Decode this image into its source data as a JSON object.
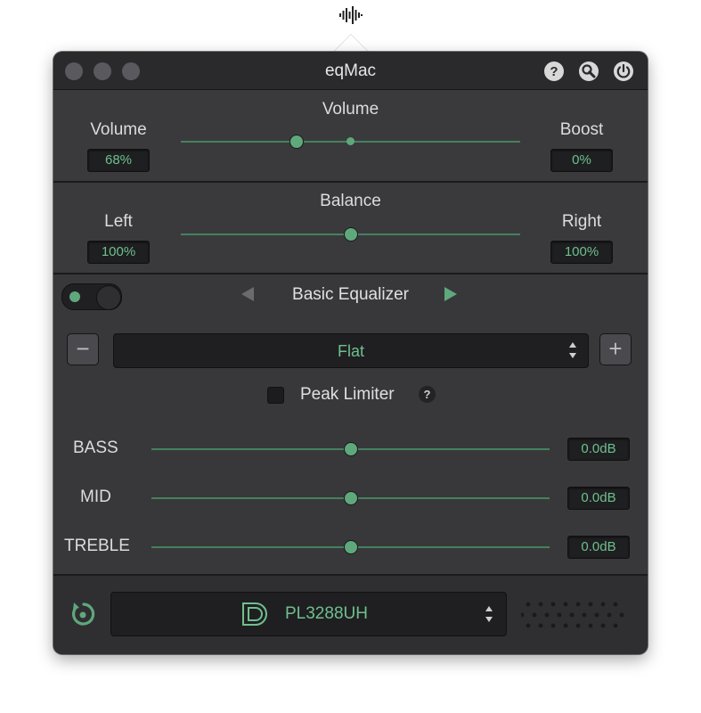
{
  "app": {
    "title": "eqMac",
    "accent_color": "#5fa87c",
    "icons": [
      "app-menubar-icon",
      "help-icon",
      "settings-icon",
      "power-icon"
    ]
  },
  "volume": {
    "title": "Volume",
    "left_label": "Volume",
    "right_label": "Boost",
    "left_value": "68%",
    "right_value": "0%",
    "slider_fraction": 0.34
  },
  "balance": {
    "title": "Balance",
    "left_label": "Left",
    "right_label": "Right",
    "left_value": "100%",
    "right_value": "100%",
    "slider_fraction": 0.5
  },
  "equalizer": {
    "enabled": true,
    "title": "Basic Equalizer",
    "preset": "Flat",
    "remove_label": "−",
    "add_label": "+",
    "peak_limiter_label": "Peak Limiter",
    "peak_limiter_help": "?",
    "peak_limiter_checked": false,
    "bands": [
      {
        "label": "BASS",
        "value": "0.0dB",
        "fraction": 0.5
      },
      {
        "label": "MID",
        "value": "0.0dB",
        "fraction": 0.5
      },
      {
        "label": "TREBLE",
        "value": "0.0dB",
        "fraction": 0.5
      }
    ]
  },
  "output": {
    "device_name": "PL3288UH",
    "icons": [
      "reset-icon",
      "displayport-icon",
      "speaker-grille-icon"
    ]
  }
}
